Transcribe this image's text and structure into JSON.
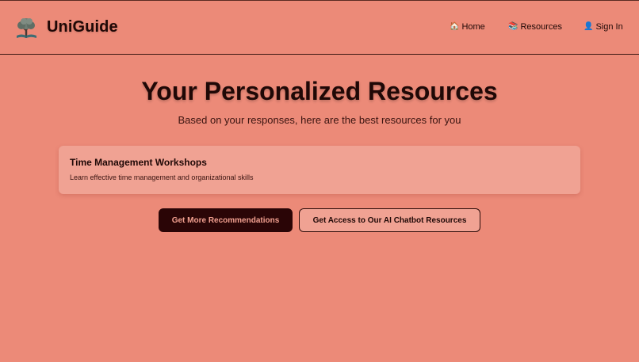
{
  "header": {
    "brand": "UniGuide",
    "logo_icon": "tree-book-icon",
    "nav": [
      {
        "label": "Home",
        "icon": "house-icon",
        "glyph": "🏠"
      },
      {
        "label": "Resources",
        "icon": "book-icon",
        "glyph": "📚"
      },
      {
        "label": "Sign In",
        "icon": "user-icon",
        "glyph": "👤"
      }
    ]
  },
  "main": {
    "title": "Your Personalized Resources",
    "subtitle": "Based on your responses, here are the best resources for you",
    "resources": [
      {
        "title": "Time Management Workshops",
        "description": "Learn effective time management and organizational skills"
      }
    ],
    "buttons": {
      "more": "Get More Recommendations",
      "chatbot": "Get Access to Our AI Chatbot Resources"
    }
  },
  "colors": {
    "background": "#ec8a78",
    "card": "#f0a293",
    "primary_button": "#2a0506",
    "text_dark": "#1f0806"
  }
}
